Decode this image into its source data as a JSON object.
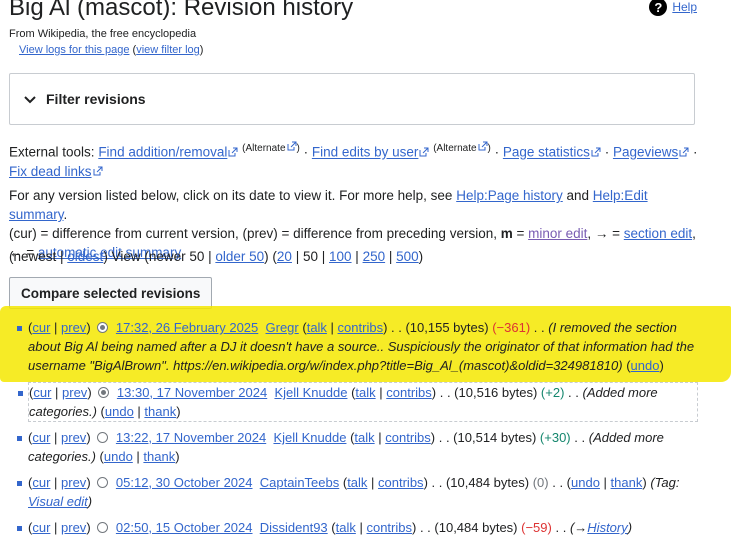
{
  "header": {
    "title": "Big Al (mascot): Revision history",
    "help_label": "Help",
    "help_glyph": "?",
    "tagline": "From Wikipedia, the free encyclopedia",
    "view_logs": "View logs for this page",
    "filter_log": "view filter log",
    "paren_open": "(",
    "paren_close": ")"
  },
  "filter": {
    "label": "Filter revisions"
  },
  "tools": {
    "prefix": "External tools:",
    "find_add_remove": "Find addition/removal",
    "alternate_1": "(Alternate",
    "alternate_close_1": ")",
    "find_edits": "Find edits by user",
    "alternate_2": "(Alternate",
    "alternate_close_2": ")",
    "page_stats": "Page statistics",
    "pageviews": "Pageviews",
    "fix_dead": "Fix dead links",
    "sep": " · "
  },
  "instructions": {
    "line1_a": "For any version listed below, click on its date to view it. For more help, see ",
    "help_page_history": "Help:Page history",
    "and": " and ",
    "help_edit_summary": "Help:Edit summary",
    "period": ".",
    "line2_a": "(cur) = difference from current version, (prev) = difference from preceding version, ",
    "m": "m",
    "eq": " = ",
    "minor_edit": "minor edit",
    "comma_arrow": ", → = ",
    "section_edit": "section edit",
    "comma": ",",
    "line3_arrow": "← = ",
    "auto_summary": "automatic edit summary"
  },
  "nav": {
    "open": "(newest | ",
    "oldest": "oldest",
    "view": ") View (newer 50 | ",
    "older": "older 50",
    "mid": ") (",
    "n20": "20",
    "bar": " | ",
    "n50": "50",
    "n100": "100",
    "n250": "250",
    "n500": "500",
    "close": ")"
  },
  "compare_button": "Compare selected revisions",
  "revisions": [
    {
      "cur": "cur",
      "prev": "prev",
      "date": "17:32, 26 February 2025",
      "user": "Gregr",
      "talk": "talk",
      "contribs": "contribs",
      "bytes": ". . (10,155 bytes)",
      "diff": "(−361)",
      "dots": ". .",
      "comment": "(I removed the section about Big Al being named after a DJ it doesn't have a source.. Suspiciously the originator of that information had the username \"BigAlBrown\". https://en.wikipedia.org/w/index.php?title=Big_Al_(mascot)&oldid=324981810)",
      "undo": "undo"
    },
    {
      "cur": "cur",
      "prev": "prev",
      "date": "13:30, 17 November 2024",
      "user": "Kjell Knudde",
      "talk": "talk",
      "contribs": "contribs",
      "bytes": ". . (10,516 bytes)",
      "diff": "(+2)",
      "dots": ". .",
      "comment": "(Added more categories.)",
      "undo": "undo",
      "thank": "thank"
    },
    {
      "cur": "cur",
      "prev": "prev",
      "date": "13:22, 17 November 2024",
      "user": "Kjell Knudde",
      "talk": "talk",
      "contribs": "contribs",
      "bytes": ". . (10,514 bytes)",
      "diff": "(+30)",
      "dots": ". .",
      "comment": "(Added more categories.)",
      "undo": "undo",
      "thank": "thank"
    },
    {
      "cur": "cur",
      "prev": "prev",
      "date": "05:12, 30 October 2024",
      "user": "CaptainTeebs",
      "talk": "talk",
      "contribs": "contribs",
      "bytes": ". . (10,484 bytes)",
      "diff": "(0)",
      "dots": ". .",
      "undo": "undo",
      "thank": "thank",
      "tag_prefix": "(Tag:",
      "tag": "Visual edit",
      "tag_close": ")"
    },
    {
      "cur": "cur",
      "prev": "prev",
      "date": "02:50, 15 October 2024",
      "user": "Dissident93",
      "talk": "talk",
      "contribs": "contribs",
      "bytes": ". . (10,484 bytes)",
      "diff": "(−59)",
      "dots": ". .",
      "section_arrow": "(→",
      "section": "History",
      "section_close": ")"
    }
  ],
  "colors": {
    "link": "#3366cc",
    "highlight": "#f5e800",
    "negative": "#dd3333",
    "positive": "#14866d"
  }
}
